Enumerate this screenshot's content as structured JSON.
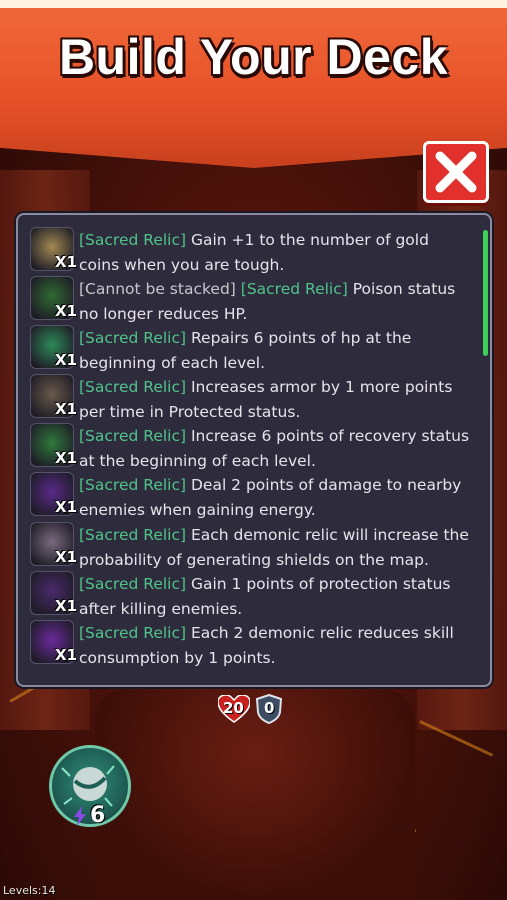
{
  "header": {
    "title": "Build Your Deck"
  },
  "relics": [
    {
      "parts": [
        {
          "text": "[Sacred Relic]",
          "kind": "tag"
        },
        {
          "text": " Gain +1 to the number of gold coins when you are tough.",
          "kind": "plain"
        }
      ],
      "count": "X1",
      "icon": "gold-pouch-icon",
      "color": "#a38a52"
    },
    {
      "parts": [
        {
          "text": "[Cannot be stacked]",
          "kind": "tag2"
        },
        {
          "text": " ",
          "kind": "plain"
        },
        {
          "text": "[Sacred Relic]",
          "kind": "tag"
        },
        {
          "text": " Poison status no longer reduces HP.",
          "kind": "plain"
        }
      ],
      "count": "X1",
      "icon": "skeleton-hand-icon",
      "color": "#2f6a32"
    },
    {
      "parts": [
        {
          "text": "[Sacred Relic]",
          "kind": "tag"
        },
        {
          "text": " Repairs 6 points of hp at the beginning of each level.",
          "kind": "plain"
        }
      ],
      "count": "X1",
      "icon": "potion-vial-icon",
      "color": "#2d8a58"
    },
    {
      "parts": [
        {
          "text": "[Sacred Relic]",
          "kind": "tag"
        },
        {
          "text": " Increases armor by 1 more points per time in Protected status.",
          "kind": "plain"
        }
      ],
      "count": "X1",
      "icon": "barrel-icon",
      "color": "#6a5a4a"
    },
    {
      "parts": [
        {
          "text": "[Sacred Relic]",
          "kind": "tag"
        },
        {
          "text": " Increase 6 points of recovery status at the beginning of each level.",
          "kind": "plain"
        }
      ],
      "count": "X1",
      "icon": "carrot-icon",
      "color": "#2f7a3c"
    },
    {
      "parts": [
        {
          "text": "[Sacred Relic]",
          "kind": "tag"
        },
        {
          "text": " Deal 2 points of damage to nearby enemies when gaining energy.",
          "kind": "plain"
        }
      ],
      "count": "X1",
      "icon": "purple-orb-icon",
      "color": "#5a2a8a"
    },
    {
      "parts": [
        {
          "text": "[Sacred Relic]",
          "kind": "tag"
        },
        {
          "text": " Each demonic relic will increase the probability of generating shields on the map.",
          "kind": "plain"
        }
      ],
      "count": "X1",
      "icon": "demonic-scroll-icon",
      "color": "#7a6a7e"
    },
    {
      "parts": [
        {
          "text": "[Sacred Relic]",
          "kind": "tag"
        },
        {
          "text": " Gain 1 points of protection status after killing enemies.",
          "kind": "plain"
        }
      ],
      "count": "X1",
      "icon": "dark-claw-icon",
      "color": "#4a2a6a"
    },
    {
      "parts": [
        {
          "text": "[Sacred Relic]",
          "kind": "tag"
        },
        {
          "text": " Each 2 demonic relic reduces skill consumption by 1 points.",
          "kind": "plain"
        }
      ],
      "count": "X1",
      "icon": "demonic-rune-icon",
      "color": "#6a2a9a"
    }
  ],
  "stats": {
    "hp": "20",
    "armor": "0"
  },
  "skill": {
    "cost": "6"
  },
  "footer": {
    "level": "Levels:14"
  }
}
